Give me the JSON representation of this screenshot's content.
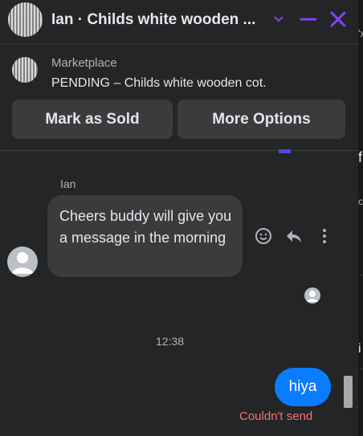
{
  "header": {
    "title": "Ian · Childs white wooden ...",
    "avatar_icon": "crib-photo-thumbnail",
    "actions": [
      "chevron-down-icon",
      "minimize-icon",
      "close-icon"
    ],
    "accent_color": "#8a3ffc"
  },
  "marketplace": {
    "label": "Marketplace",
    "status": "PENDING – Childs white wooden cot.",
    "buttons": {
      "mark_sold": "Mark as Sold",
      "more_options": "More Options"
    }
  },
  "messages": {
    "sender_name": "Ian",
    "incoming_text": "Cheers buddy will give you a message in the morning",
    "message_actions": [
      "react-emoji-icon",
      "reply-icon",
      "more-options-icon"
    ],
    "timestamp": "12:38",
    "outgoing_text": "hiya",
    "outgoing_color": "#0a7cff",
    "error_text": "Couldn't send",
    "error_color": "#f3727a"
  },
  "right_panel": {
    "fragments": [
      "'x",
      "f",
      "c",
      "i"
    ]
  }
}
